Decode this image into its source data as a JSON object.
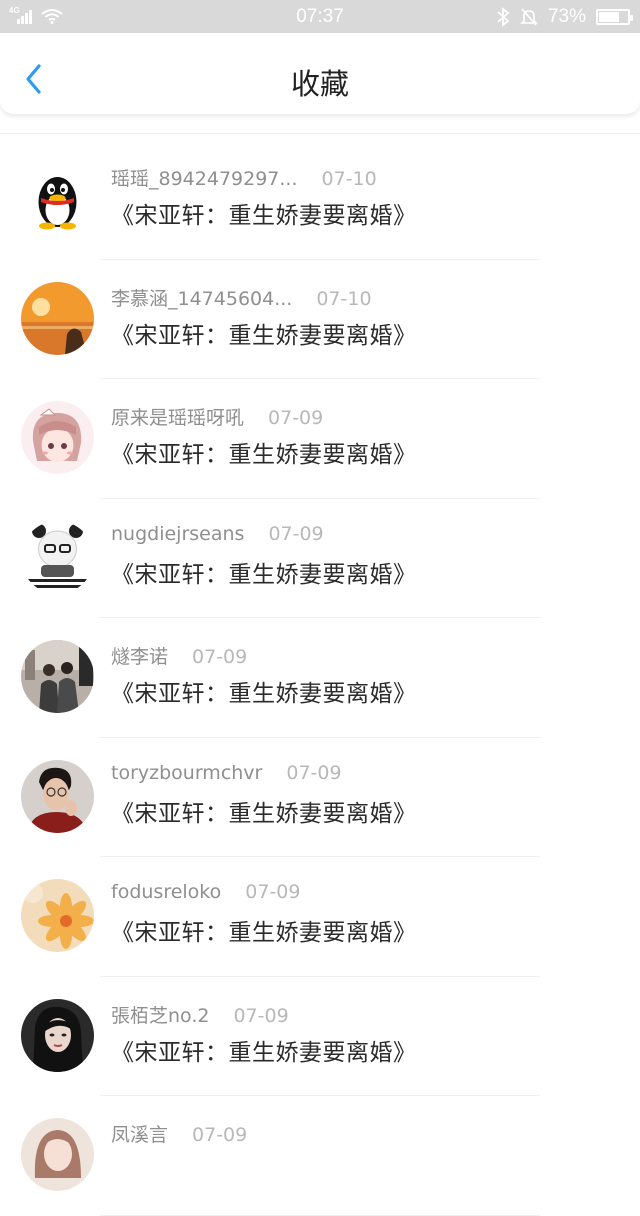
{
  "status_bar": {
    "network": "4G",
    "time": "07:37",
    "battery_percent": "73%",
    "battery_level": 0.73,
    "icons": [
      "signal-icon",
      "wifi-icon",
      "bluetooth-icon",
      "mute-icon",
      "battery-icon"
    ]
  },
  "header": {
    "title": "收藏",
    "back_icon": "chevron-left-icon",
    "accent": "#2d9cf0"
  },
  "items": [
    {
      "username": "瑶瑶_8942479297...",
      "date": "07-10",
      "content": "《宋亚轩：重生娇妻要离婚》",
      "avatar": "penguin"
    },
    {
      "username": "李慕涵_14745604...",
      "date": "07-10",
      "content": "《宋亚轩：重生娇妻要离婚》",
      "avatar": "sunset"
    },
    {
      "username": "原来是瑶瑶呀吼",
      "date": "07-09",
      "content": "《宋亚轩：重生娇妻要离婚》",
      "avatar": "anime-girl"
    },
    {
      "username": "nugdiejrseans",
      "date": "07-09",
      "content": "《宋亚轩：重生娇妻要离婚》",
      "avatar": "panda-meme"
    },
    {
      "username": "燧李诺",
      "date": "07-09",
      "content": "《宋亚轩：重生娇妻要离婚》",
      "avatar": "couple-photo"
    },
    {
      "username": "toryzbourmchvr",
      "date": "07-09",
      "content": "《宋亚轩：重生娇妻要离婚》",
      "avatar": "man-portrait"
    },
    {
      "username": "fodusreloko",
      "date": "07-09",
      "content": "《宋亚轩：重生娇妻要离婚》",
      "avatar": "flower"
    },
    {
      "username": "張栢芝no.2",
      "date": "07-09",
      "content": "《宋亚轩：重生娇妻要离婚》",
      "avatar": "woman-portrait"
    },
    {
      "username": "凤溪言",
      "date": "07-09",
      "content": "",
      "avatar": "girl-portrait"
    }
  ]
}
